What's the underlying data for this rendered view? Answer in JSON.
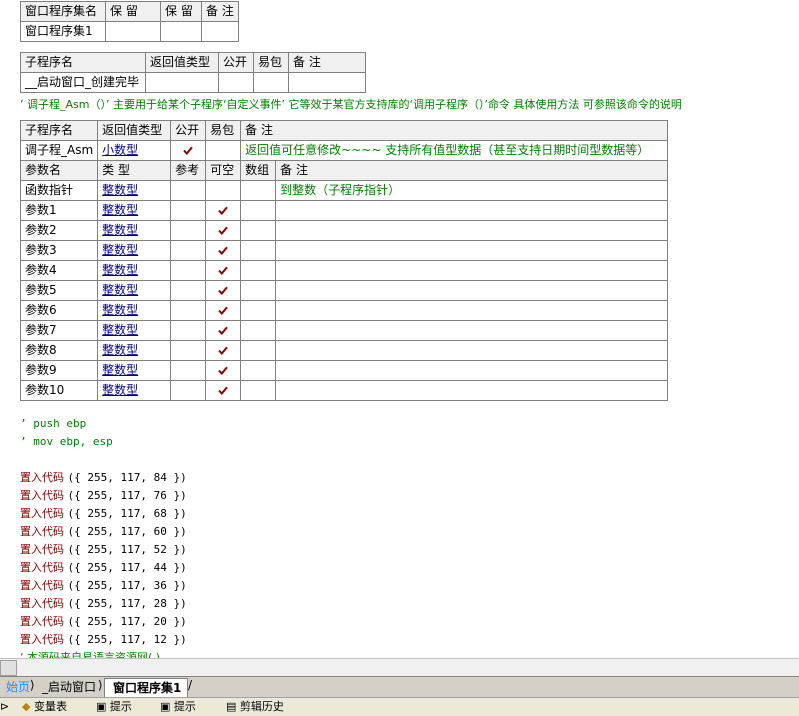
{
  "assembly_table": {
    "headers": [
      "窗口程序集名",
      "保 留",
      "保 留",
      "备 注"
    ],
    "row": [
      "窗口程序集1",
      "",
      "",
      ""
    ]
  },
  "sub1_table": {
    "headers": [
      "子程序名",
      "返回值类型",
      "公开",
      "易包",
      "备 注"
    ],
    "row": [
      "__启动窗口_创建完毕",
      "",
      "",
      "",
      ""
    ]
  },
  "comment_line": "’ 调子程_Asm（）’  主要用于给某个子程序‘自定义事件’ 它等效于某官方支持库的‘调用子程序（）’命令 具体使用方法 可参照该命令的说明",
  "sub2_table": {
    "headers": [
      "子程序名",
      "返回值类型",
      "公开",
      "易包",
      "备 注"
    ],
    "row": {
      "name": "调子程_Asm",
      "type": "小数型",
      "public": true,
      "pack": false,
      "note": "返回值可任意修改~~~~  支持所有值型数据（甚至支持日期时间型数据等）"
    },
    "param_headers": [
      "参数名",
      "类 型",
      "参考",
      "可空",
      "数组",
      "备 注"
    ],
    "params": [
      {
        "name": "函数指针",
        "type": "整数型",
        "ref": false,
        "nullable": false,
        "array": false,
        "note": "到整数（子程序指针）"
      },
      {
        "name": "参数1",
        "type": "整数型",
        "ref": false,
        "nullable": true,
        "array": false,
        "note": ""
      },
      {
        "name": "参数2",
        "type": "整数型",
        "ref": false,
        "nullable": true,
        "array": false,
        "note": ""
      },
      {
        "name": "参数3",
        "type": "整数型",
        "ref": false,
        "nullable": true,
        "array": false,
        "note": ""
      },
      {
        "name": "参数4",
        "type": "整数型",
        "ref": false,
        "nullable": true,
        "array": false,
        "note": ""
      },
      {
        "name": "参数5",
        "type": "整数型",
        "ref": false,
        "nullable": true,
        "array": false,
        "note": ""
      },
      {
        "name": "参数6",
        "type": "整数型",
        "ref": false,
        "nullable": true,
        "array": false,
        "note": ""
      },
      {
        "name": "参数7",
        "type": "整数型",
        "ref": false,
        "nullable": true,
        "array": false,
        "note": ""
      },
      {
        "name": "参数8",
        "type": "整数型",
        "ref": false,
        "nullable": true,
        "array": false,
        "note": ""
      },
      {
        "name": "参数9",
        "type": "整数型",
        "ref": false,
        "nullable": true,
        "array": false,
        "note": ""
      },
      {
        "name": "参数10",
        "type": "整数型",
        "ref": false,
        "nullable": true,
        "array": false,
        "note": ""
      }
    ]
  },
  "asm_comments": [
    "’ push ebp",
    "’ mov ebp, esp"
  ],
  "code_lines": [
    {
      "kw": "置入代码",
      "args": "({ 255, 117, 84 })"
    },
    {
      "kw": "置入代码",
      "args": "({ 255, 117, 76 })"
    },
    {
      "kw": "置入代码",
      "args": "({ 255, 117, 68 })"
    },
    {
      "kw": "置入代码",
      "args": "({ 255, 117, 60 })"
    },
    {
      "kw": "置入代码",
      "args": "({ 255, 117, 52 })"
    },
    {
      "kw": "置入代码",
      "args": "({ 255, 117, 44 })"
    },
    {
      "kw": "置入代码",
      "args": "({ 255, 117, 36 })"
    },
    {
      "kw": "置入代码",
      "args": "({ 255, 117, 28 })"
    },
    {
      "kw": "置入代码",
      "args": "({ 255, 117, 20 })"
    },
    {
      "kw": "置入代码",
      "args": "({ 255, 117, 12 })"
    }
  ],
  "cut_line": "’ 本源码来自易语言资源网(            )",
  "tabs": [
    "始页",
    "_启动窗口",
    "窗口程序集1"
  ],
  "bottom_items": [
    "变量表",
    "提示",
    "提示",
    "剪辑历史"
  ],
  "colors": {
    "keyword": "#8b0000",
    "comment": "#008000",
    "type": "#00008b",
    "check": "#8b0000"
  }
}
